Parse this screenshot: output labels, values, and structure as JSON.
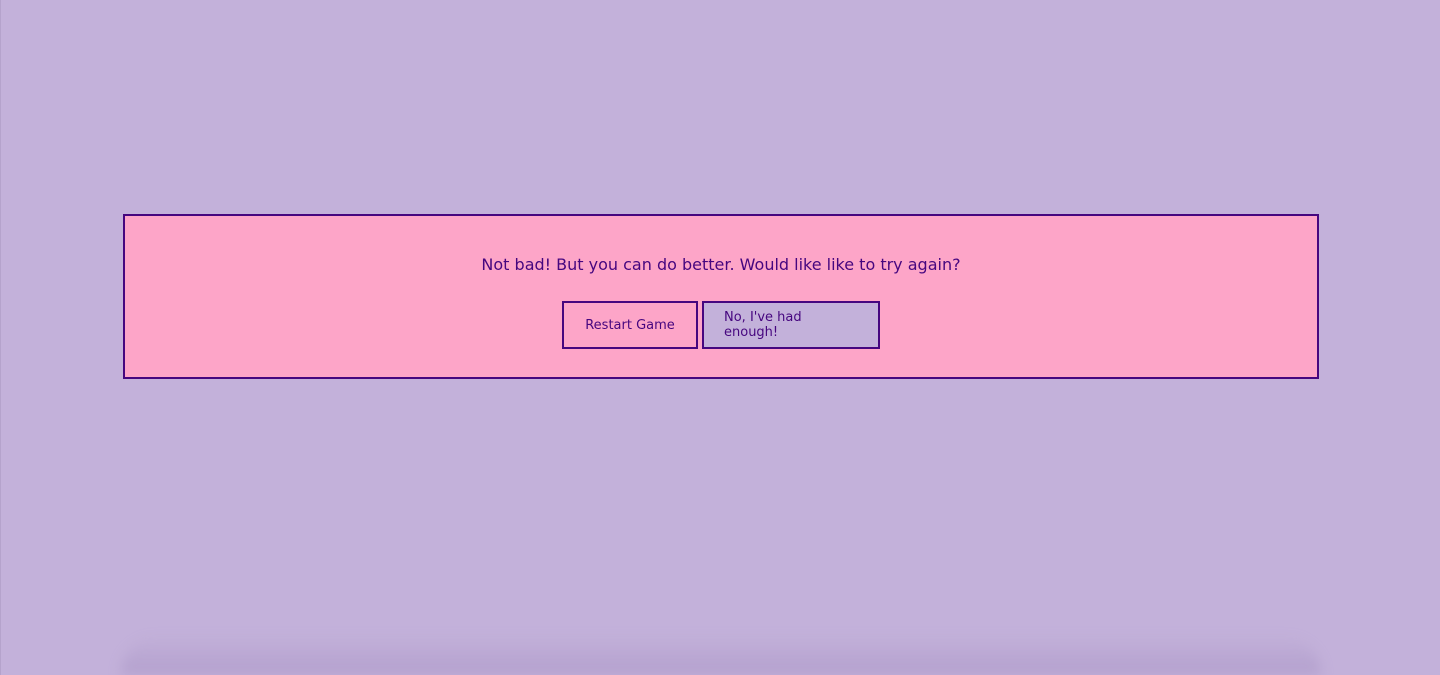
{
  "dialog": {
    "message": "Not bad! But you can do better. Would like like to try again?",
    "restart_label": "Restart Game",
    "quit_label": "No, I've had enough!"
  },
  "colors": {
    "background": "#c3b1da",
    "dialog_background": "#fda5c8",
    "accent": "#46067f"
  }
}
